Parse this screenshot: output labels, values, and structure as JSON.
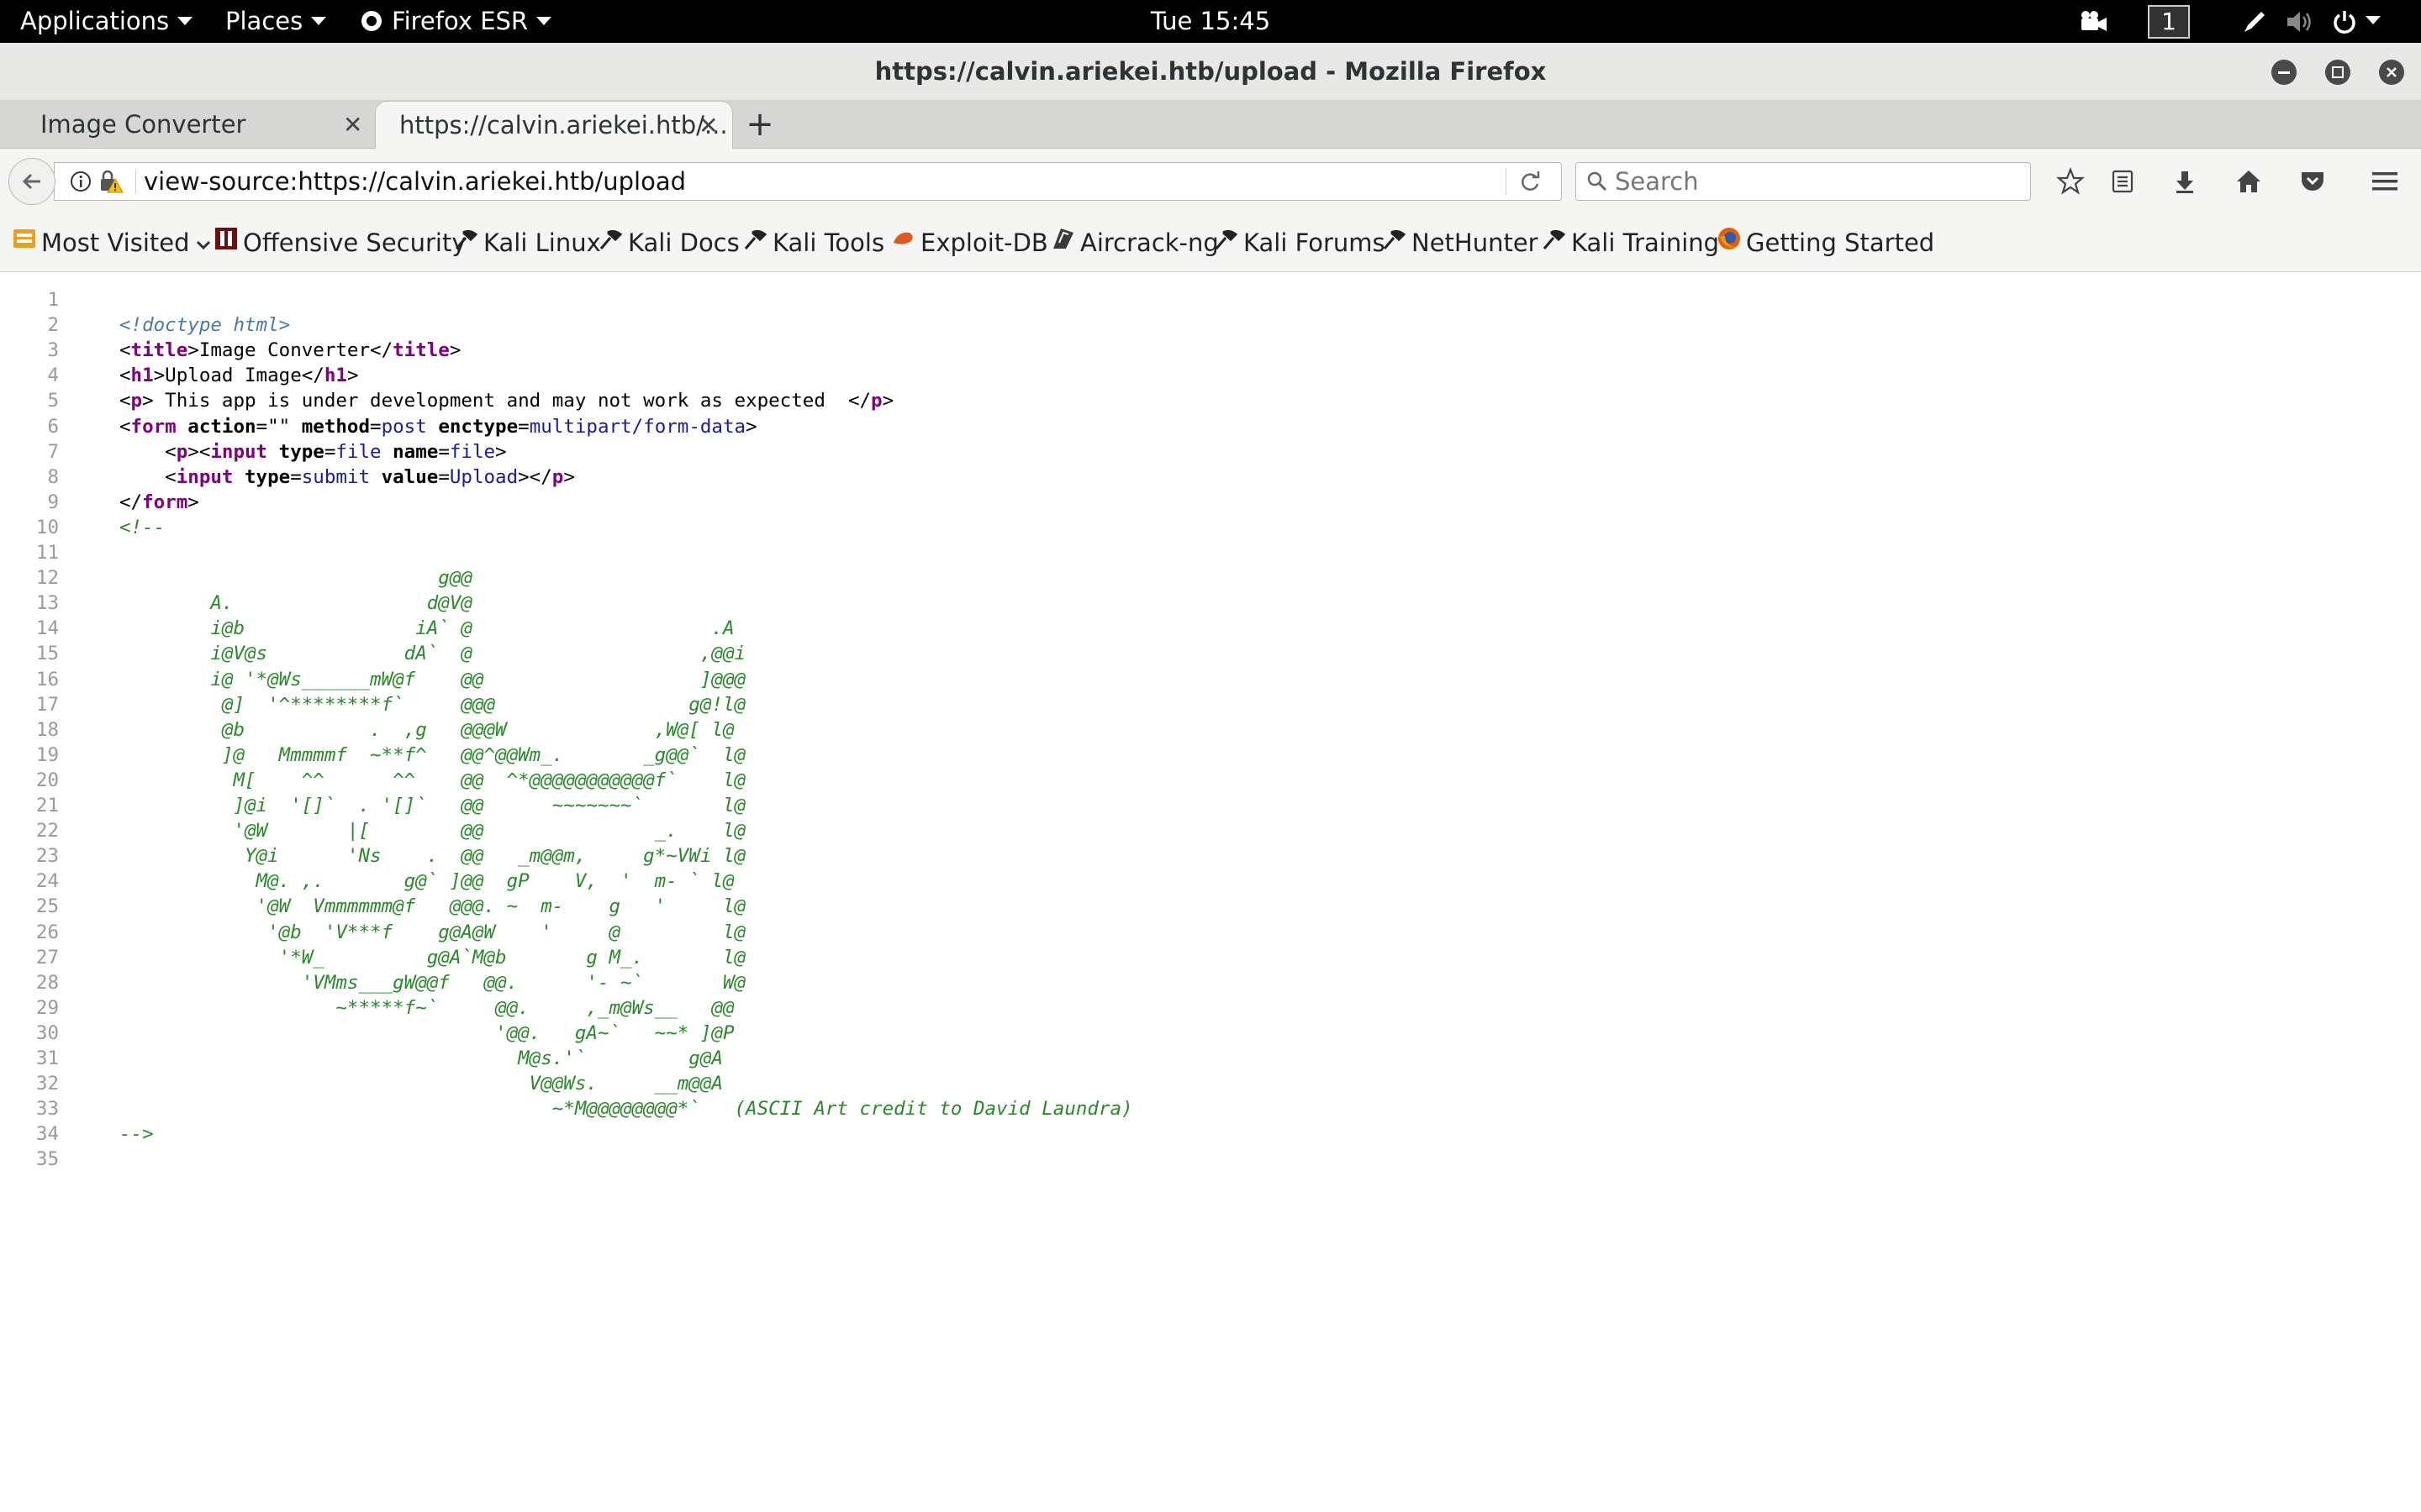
{
  "topbar": {
    "applications": "Applications",
    "places": "Places",
    "firefox": "Firefox ESR",
    "clock": "Tue 15:45",
    "workspace": "1"
  },
  "window": {
    "title": "https://calvin.ariekei.htb/upload - Mozilla Firefox"
  },
  "tabs": [
    {
      "label": "Image Converter"
    },
    {
      "label": "https://calvin.ariekei.htb/..."
    }
  ],
  "navbar": {
    "url": "view-source:https://calvin.ariekei.htb/upload",
    "search_placeholder": "Search"
  },
  "bookmarks": [
    {
      "label": "Most Visited",
      "icon": "most-visited-icon"
    },
    {
      "label": "Offensive Security",
      "icon": "offsec-icon"
    },
    {
      "label": "Kali Linux",
      "icon": "kali-icon"
    },
    {
      "label": "Kali Docs",
      "icon": "kali-icon"
    },
    {
      "label": "Kali Tools",
      "icon": "kali-icon"
    },
    {
      "label": "Exploit-DB",
      "icon": "exploitdb-icon"
    },
    {
      "label": "Aircrack-ng",
      "icon": "aircrack-icon"
    },
    {
      "label": "Kali Forums",
      "icon": "kali-icon"
    },
    {
      "label": "NetHunter",
      "icon": "kali-icon"
    },
    {
      "label": "Kali Training",
      "icon": "kali-icon"
    },
    {
      "label": "Getting Started",
      "icon": "firefox-icon"
    }
  ],
  "source": {
    "line_numbers": [
      "1",
      "2",
      "3",
      "4",
      "5",
      "6",
      "7",
      "8",
      "9",
      "10",
      "11",
      "12",
      "13",
      "14",
      "15",
      "16",
      "17",
      "18",
      "19",
      "20",
      "21",
      "22",
      "23",
      "24",
      "25",
      "26",
      "27",
      "28",
      "29",
      "30",
      "31",
      "32",
      "33",
      "34",
      "35"
    ],
    "lines": [
      [],
      [
        {
          "c": "doctype",
          "t": "<!doctype html>"
        }
      ],
      [
        {
          "c": "",
          "t": "<"
        },
        {
          "c": "tag",
          "t": "title"
        },
        {
          "c": "",
          "t": ">Image Converter</"
        },
        {
          "c": "tag",
          "t": "title"
        },
        {
          "c": "",
          "t": ">"
        }
      ],
      [
        {
          "c": "",
          "t": "<"
        },
        {
          "c": "tag",
          "t": "h1"
        },
        {
          "c": "",
          "t": ">Upload Image</"
        },
        {
          "c": "tag",
          "t": "h1"
        },
        {
          "c": "",
          "t": ">"
        }
      ],
      [
        {
          "c": "",
          "t": "<"
        },
        {
          "c": "tag",
          "t": "p"
        },
        {
          "c": "",
          "t": "> This app is under development and may not work as expected  </"
        },
        {
          "c": "tag",
          "t": "p"
        },
        {
          "c": "",
          "t": ">"
        }
      ],
      [
        {
          "c": "",
          "t": "<"
        },
        {
          "c": "tag",
          "t": "form"
        },
        {
          "c": "",
          "t": " "
        },
        {
          "c": "attr",
          "t": "action"
        },
        {
          "c": "",
          "t": "=\"\" "
        },
        {
          "c": "attr",
          "t": "method"
        },
        {
          "c": "",
          "t": "="
        },
        {
          "c": "val",
          "t": "post"
        },
        {
          "c": "",
          "t": " "
        },
        {
          "c": "attr",
          "t": "enctype"
        },
        {
          "c": "",
          "t": "="
        },
        {
          "c": "val",
          "t": "multipart/form-data"
        },
        {
          "c": "",
          "t": ">"
        }
      ],
      [
        {
          "c": "",
          "t": "    <"
        },
        {
          "c": "tag",
          "t": "p"
        },
        {
          "c": "",
          "t": "><"
        },
        {
          "c": "tag",
          "t": "input"
        },
        {
          "c": "",
          "t": " "
        },
        {
          "c": "attr",
          "t": "type"
        },
        {
          "c": "",
          "t": "="
        },
        {
          "c": "val",
          "t": "file"
        },
        {
          "c": "",
          "t": " "
        },
        {
          "c": "attr",
          "t": "name"
        },
        {
          "c": "",
          "t": "="
        },
        {
          "c": "val",
          "t": "file"
        },
        {
          "c": "",
          "t": ">"
        }
      ],
      [
        {
          "c": "",
          "t": "    <"
        },
        {
          "c": "tag",
          "t": "input"
        },
        {
          "c": "",
          "t": " "
        },
        {
          "c": "attr",
          "t": "type"
        },
        {
          "c": "",
          "t": "="
        },
        {
          "c": "val",
          "t": "submit"
        },
        {
          "c": "",
          "t": " "
        },
        {
          "c": "attr",
          "t": "value"
        },
        {
          "c": "",
          "t": "="
        },
        {
          "c": "val",
          "t": "Upload"
        },
        {
          "c": "",
          "t": "></"
        },
        {
          "c": "tag",
          "t": "p"
        },
        {
          "c": "",
          "t": ">"
        }
      ],
      [
        {
          "c": "",
          "t": "</"
        },
        {
          "c": "tag",
          "t": "form"
        },
        {
          "c": "",
          "t": ">"
        }
      ],
      [
        {
          "c": "cmt",
          "t": "<!--"
        }
      ],
      [],
      [
        {
          "c": "cmt",
          "t": "                            g@@"
        }
      ],
      [
        {
          "c": "cmt",
          "t": "        A.                 d@V@"
        }
      ],
      [
        {
          "c": "cmt",
          "t": "        i@b               iA` @                     .A"
        }
      ],
      [
        {
          "c": "cmt",
          "t": "        i@V@s            dA`  @                    ,@@i"
        }
      ],
      [
        {
          "c": "cmt",
          "t": "        i@ '*@Ws______mW@f    @@                   ]@@@"
        }
      ],
      [
        {
          "c": "cmt",
          "t": "         @]  '^********f`     @@@                 g@!l@"
        }
      ],
      [
        {
          "c": "cmt",
          "t": "         @b           .  ,g   @@@W             ,W@[ l@"
        }
      ],
      [
        {
          "c": "cmt",
          "t": "         ]@   Mmmmmf  ~**f^   @@^@@Wm_.       _g@@`  l@"
        }
      ],
      [
        {
          "c": "cmt",
          "t": "          M[    ^^      ^^    @@  ^*@@@@@@@@@@@f`    l@"
        }
      ],
      [
        {
          "c": "cmt",
          "t": "          ]@i  '[]`  . '[]`   @@      ~~~~~~~`       l@"
        }
      ],
      [
        {
          "c": "cmt",
          "t": "          '@W       |[        @@               _.    l@"
        }
      ],
      [
        {
          "c": "cmt",
          "t": "           Y@i      'Ns    .  @@   _m@@m,     g*~VWi l@"
        }
      ],
      [
        {
          "c": "cmt",
          "t": "            M@. ,.       g@` ]@@  gP    V,  '  m- ` l@"
        }
      ],
      [
        {
          "c": "cmt",
          "t": "            '@W  Vmmmmmm@f   @@@. ~  m-    g   '     l@"
        }
      ],
      [
        {
          "c": "cmt",
          "t": "             '@b  'V***f    g@A@W    '     @         l@"
        }
      ],
      [
        {
          "c": "cmt",
          "t": "              '*W_         g@A`M@b       g M_.       l@"
        }
      ],
      [
        {
          "c": "cmt",
          "t": "                'VMms___gW@@f   @@.      '- ~`       W@"
        }
      ],
      [
        {
          "c": "cmt",
          "t": "                   ~*****f~`     @@.     ,_m@Ws__   @@"
        }
      ],
      [
        {
          "c": "cmt",
          "t": "                                 '@@.   gA~`   ~~* ]@P"
        }
      ],
      [
        {
          "c": "cmt",
          "t": "                                   M@s.'`         g@A"
        }
      ],
      [
        {
          "c": "cmt",
          "t": "                                    V@@Ws.     __m@@A"
        }
      ],
      [
        {
          "c": "cmt",
          "t": "                                      ~*M@@@@@@@@*`   (ASCII Art credit to David Laundra)"
        }
      ],
      [
        {
          "c": "cmt",
          "t": "-->"
        }
      ],
      []
    ]
  },
  "colors": {
    "tag": "#800080",
    "value": "#1a1aa6",
    "comment": "#2a8a2a",
    "doctype": "#4a7aa6",
    "line_number": "#9a9a9a"
  }
}
